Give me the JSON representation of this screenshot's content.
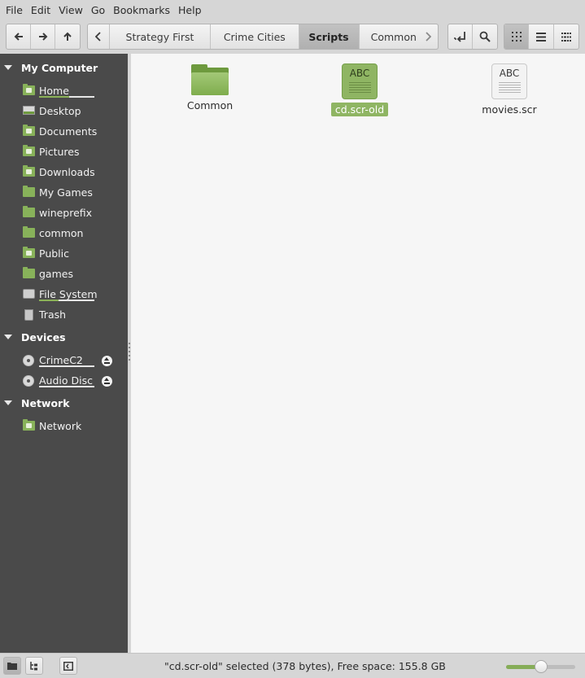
{
  "menubar": [
    "File",
    "Edit",
    "View",
    "Go",
    "Bookmarks",
    "Help"
  ],
  "toolbar": {
    "breadcrumbs": [
      {
        "label": "Strategy First",
        "active": false
      },
      {
        "label": "Crime Cities",
        "active": false
      },
      {
        "label": "Scripts",
        "active": true
      },
      {
        "label": "Common",
        "active": false
      }
    ],
    "nav_icons": [
      "back-arrow-icon",
      "forward-arrow-icon",
      "up-arrow-icon"
    ],
    "view_modes": [
      "icon-view",
      "list-view",
      "compact-view"
    ],
    "active_view": "icon-view"
  },
  "sidebar": {
    "sections": [
      {
        "title": "My Computer",
        "items": [
          {
            "label": "Home",
            "icon": "home-folder-icon",
            "usage": 0.55
          },
          {
            "label": "Desktop",
            "icon": "desktop-icon"
          },
          {
            "label": "Documents",
            "icon": "documents-folder-icon"
          },
          {
            "label": "Pictures",
            "icon": "pictures-folder-icon"
          },
          {
            "label": "Downloads",
            "icon": "downloads-folder-icon"
          },
          {
            "label": "My Games",
            "icon": "folder-icon"
          },
          {
            "label": "wineprefix",
            "icon": "folder-icon"
          },
          {
            "label": "common",
            "icon": "folder-icon"
          },
          {
            "label": "Public",
            "icon": "public-folder-icon"
          },
          {
            "label": "games",
            "icon": "folder-icon"
          },
          {
            "label": "File System",
            "icon": "drive-icon",
            "usage": 0.35
          },
          {
            "label": "Trash",
            "icon": "trash-icon"
          }
        ]
      },
      {
        "title": "Devices",
        "items": [
          {
            "label": "CrimeC2",
            "icon": "disc-icon",
            "usage": 1.0,
            "eject": true
          },
          {
            "label": "Audio Disc",
            "icon": "disc-icon",
            "usage": 1.0,
            "eject": true
          }
        ]
      },
      {
        "title": "Network",
        "items": [
          {
            "label": "Network",
            "icon": "network-icon"
          }
        ]
      }
    ]
  },
  "files": [
    {
      "name": "Common",
      "type": "folder",
      "selected": false
    },
    {
      "name": "cd.scr-old",
      "type": "text",
      "glyph": "ABC",
      "selected": true
    },
    {
      "name": "movies.scr",
      "type": "text",
      "glyph": "ABC",
      "selected": false
    }
  ],
  "status": {
    "text": "\"cd.scr-old\" selected (378 bytes), Free space: 155.8 GB",
    "zoom_level": 0.5
  },
  "colors": {
    "accent": "#8fb563",
    "sidebar_bg": "#4a4a4a",
    "content_bg": "#f6f6f6"
  }
}
